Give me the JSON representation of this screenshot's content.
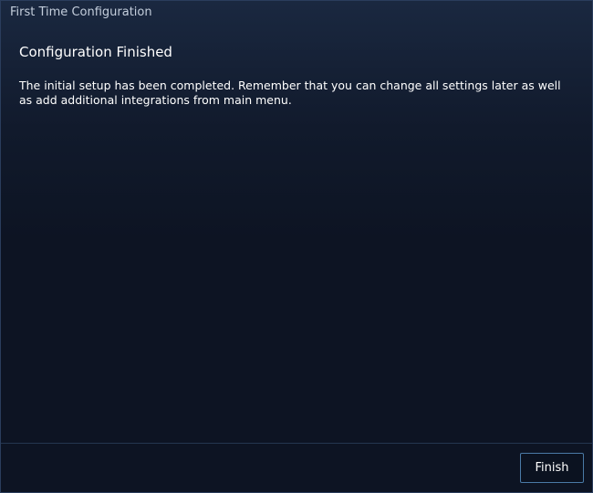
{
  "window": {
    "title": "First Time Configuration"
  },
  "content": {
    "heading": "Configuration Finished",
    "message": "The initial setup has been completed. Remember that you can change all settings later as well as add additional integrations from main menu."
  },
  "footer": {
    "finish_label": "Finish"
  }
}
